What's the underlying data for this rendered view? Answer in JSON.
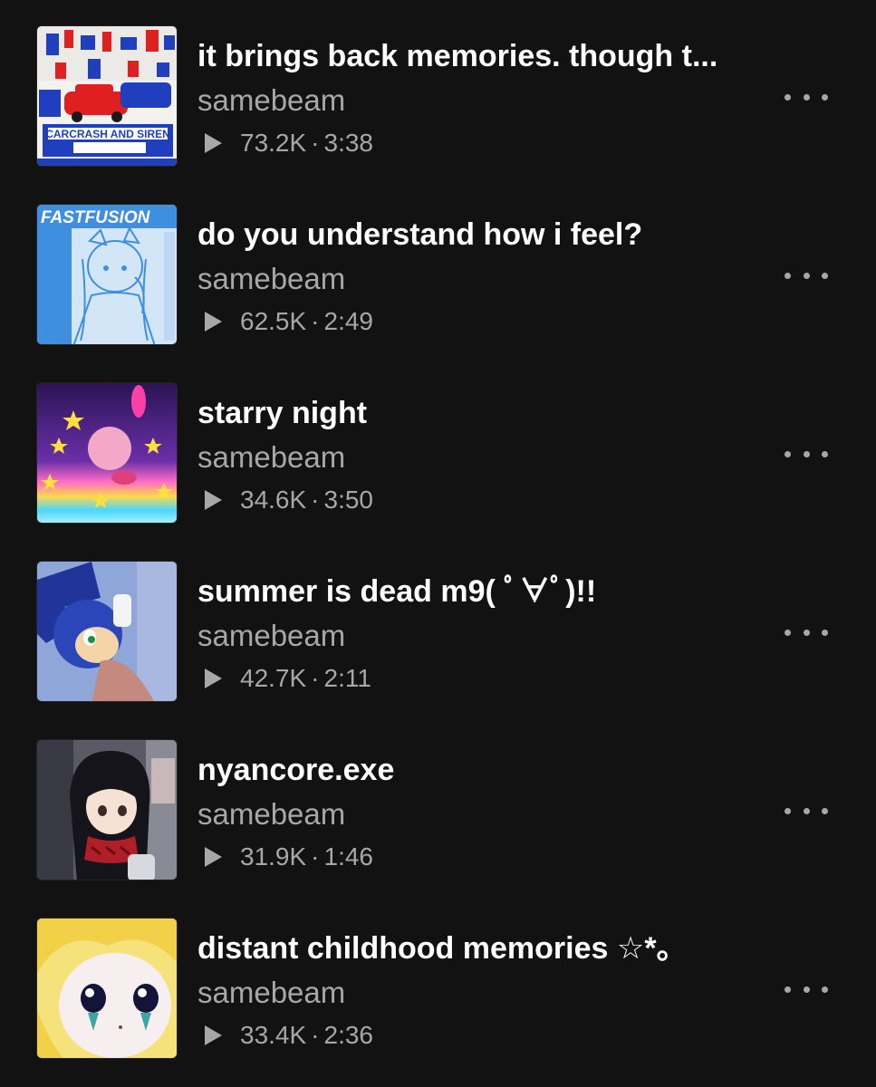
{
  "tracks": [
    {
      "title": "it brings back memories. though t...",
      "artist": "samebeam",
      "plays": "73.2K",
      "duration": "3:38",
      "thumb_text": "CARCRASH AND SIREN"
    },
    {
      "title": "do you understand how i feel?",
      "artist": "samebeam",
      "plays": "62.5K",
      "duration": "2:49",
      "thumb_text": "FASTFUSION"
    },
    {
      "title": "starry night",
      "artist": "samebeam",
      "plays": "34.6K",
      "duration": "3:50"
    },
    {
      "title": "summer is dead m9( ﾟ∀ﾟ)!!",
      "artist": "samebeam",
      "plays": "42.7K",
      "duration": "2:11"
    },
    {
      "title": "nyancore.exe",
      "artist": "samebeam",
      "plays": "31.9K",
      "duration": "1:46"
    },
    {
      "title": "distant childhood memories ☆*。",
      "artist": "samebeam",
      "plays": "33.4K",
      "duration": "2:36"
    }
  ],
  "separator": "·",
  "colors": {
    "background": "#121212",
    "title": "#ffffff",
    "secondary": "#a7a7a7"
  },
  "icons": {
    "play": "play-icon",
    "more": "more-options-icon"
  }
}
